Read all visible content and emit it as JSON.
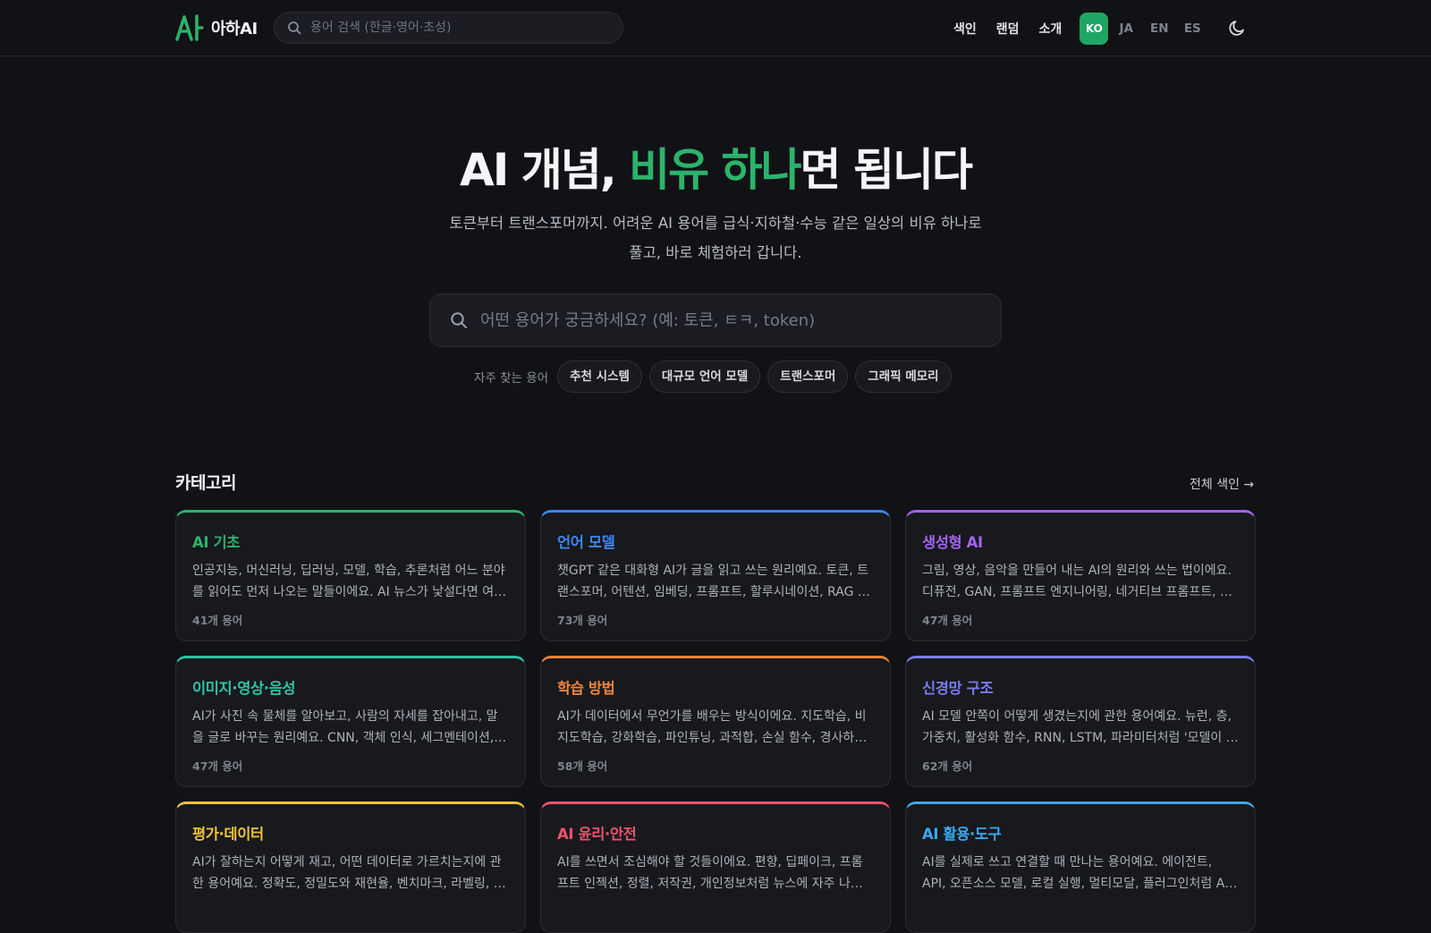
{
  "header": {
    "brand": "아하AI",
    "search_placeholder": "용어 검색 (한글·영어·초성)",
    "nav": [
      "색인",
      "랜덤",
      "소개"
    ],
    "languages": [
      "KO",
      "JA",
      "EN",
      "ES"
    ],
    "active_language": "KO",
    "accent_color": "#1fa564"
  },
  "hero": {
    "title_start": "AI 개념, ",
    "title_accent": "비유 하나",
    "title_end": "면 됩니다",
    "subtitle": "토큰부터 트랜스포머까지. 어려운 AI 용어를 급식·지하철·수능 같은 일상의 비유 하나로 풀고, 바로 체험하러 갑니다.",
    "search_placeholder": "어떤 용어가 궁금하세요? (예: 토큰, ㅌㅋ, token)",
    "popular_label": "자주 찾는 용어",
    "popular_terms": [
      "추천 시스템",
      "대규모 언어 모델",
      "트랜스포머",
      "그래픽 메모리"
    ]
  },
  "categories": {
    "title": "카테고리",
    "all_index_label": "전체 색인 →",
    "items": [
      {
        "title": "AI 기초",
        "color": "#2cb36b",
        "desc": "인공지능, 머신러닝, 딥러닝, 모델, 학습, 추론처럼 어느 분야를 읽어도 먼저 나오는 말들이에요. AI 뉴스가 낯설다면 여기서부터 시작하세요.",
        "count": "41개 용어"
      },
      {
        "title": "언어 모델",
        "color": "#3f86f0",
        "desc": "챗GPT 같은 대화형 AI가 글을 읽고 쓰는 원리예요. 토큰, 트랜스포머, 어텐션, 임베딩, 프롬프트, 할루시네이션, RAG 등을 다뤄요.",
        "count": "73개 용어"
      },
      {
        "title": "생성형 AI",
        "color": "#a463ef",
        "desc": "그림, 영상, 음악을 만들어 내는 AI의 원리와 쓰는 법이에요. 디퓨전, GAN, 프롬프트 엔지니어링, 네거티브 프롬프트, 업스케일링 등.",
        "count": "47개 용어"
      },
      {
        "title": "이미지·영상·음성",
        "color": "#2fc4a4",
        "desc": "AI가 사진 속 물체를 알아보고, 사람의 자세를 잡아내고, 말을 글로 바꾸는 원리예요. CNN, 객체 인식, 세그멘테이션, 포즈 추정 등.",
        "count": "47개 용어"
      },
      {
        "title": "학습 방법",
        "color": "#f0843a",
        "desc": "AI가 데이터에서 무언가를 배우는 방식이에요. 지도학습, 비지도학습, 강화학습, 파인튜닝, 과적합, 손실 함수, 경사하강법 등.",
        "count": "58개 용어"
      },
      {
        "title": "신경망 구조",
        "color": "#7a7cf0",
        "desc": "AI 모델 안쪽이 어떻게 생겼는지에 관한 용어예요. 뉴런, 층, 가중치, 활성화 함수, RNN, LSTM, 파라미터처럼 '모델이 크다'는 말의 뜻까지.",
        "count": "62개 용어"
      },
      {
        "title": "평가·데이터",
        "color": "#f0c23a",
        "desc": "AI가 잘하는지 어떻게 재고, 어떤 데이터로 가르치는지에 관한 용어예요. 정확도, 정밀도와 재현율, 벤치마크, 라벨링, 데이터셋 등.",
        "count": ""
      },
      {
        "title": "AI 윤리·안전",
        "color": "#f0506e",
        "desc": "AI를 쓰면서 조심해야 할 것들이에요. 편향, 딥페이크, 프롬프트 인젝션, 정렬, 저작권, 개인정보처럼 뉴스에 자주 나오는 이슈들.",
        "count": ""
      },
      {
        "title": "AI 활용·도구",
        "color": "#3aa8f0",
        "desc": "AI를 실제로 쓰고 연결할 때 만나는 용어예요. 에이전트, API, 오픈소스 모델, 로컬 실행, 멀티모달, 플러그인처럼 AI를 일에 붙이는 법.",
        "count": ""
      }
    ]
  }
}
